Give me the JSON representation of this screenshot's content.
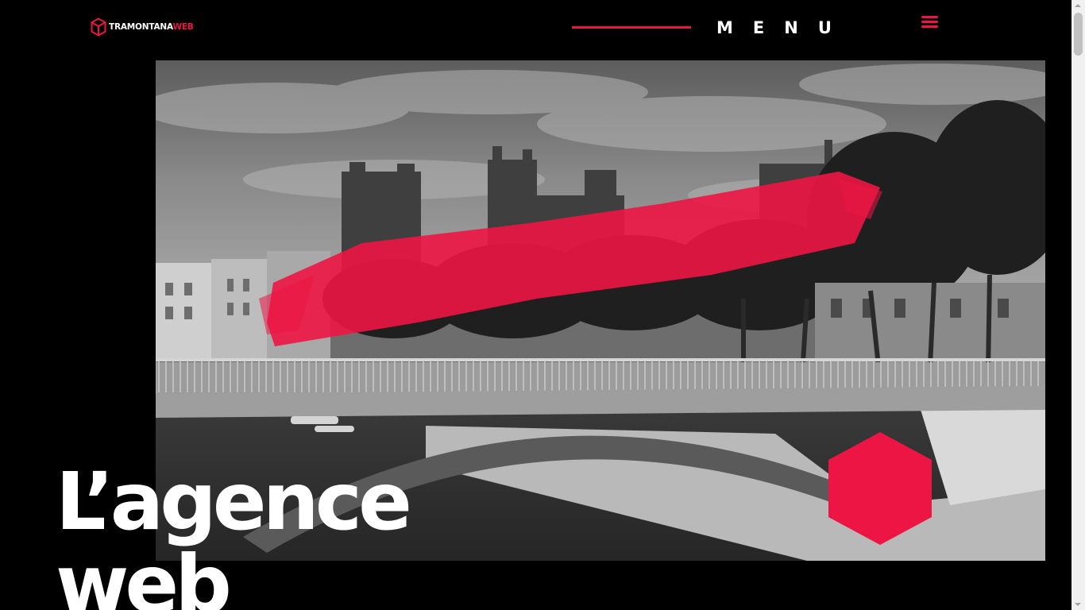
{
  "brand": {
    "name_main": "TRAMONTANA",
    "name_accent": "WEB",
    "logo_icon": "hexagon-cube-logo-icon",
    "accent_color": "#ec1543"
  },
  "header": {
    "menu_label": "MENU",
    "menu_icon": "hamburger-menu-icon"
  },
  "hero": {
    "image_subject": "bridge-over-canal-grayscale-photo",
    "headline_line1": "L’agence",
    "headline_line2": "web",
    "decoration_icon": "hexagon-shape-icon"
  },
  "colors": {
    "background": "#000000",
    "accent": "#ec1543",
    "text": "#ffffff"
  }
}
